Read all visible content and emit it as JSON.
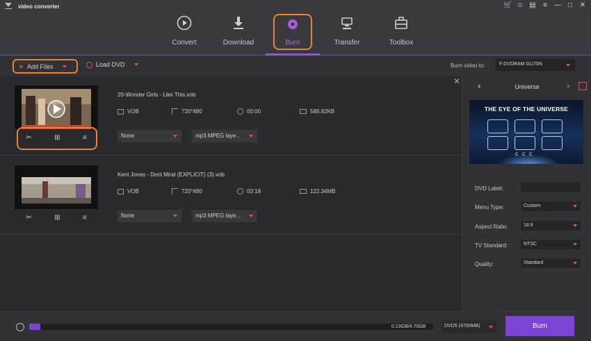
{
  "app": {
    "title": "video converter"
  },
  "colors": {
    "accent_purple": "#8b5ccf",
    "highlight_orange": "#e8833a",
    "burn_button": "#7b45d4",
    "dropdown_caret": "#e85050"
  },
  "nav": {
    "tabs": [
      {
        "label": "Convert",
        "icon": "play-circle-icon"
      },
      {
        "label": "Download",
        "icon": "download-icon"
      },
      {
        "label": "Burn",
        "icon": "disc-icon",
        "active": true
      },
      {
        "label": "Transfer",
        "icon": "transfer-icon"
      },
      {
        "label": "Toolbox",
        "icon": "toolbox-icon"
      }
    ]
  },
  "toolbar": {
    "add_files": "Add Files",
    "load_dvd": "Load DVD",
    "burn_to_label": "Burn video to:",
    "burn_to_value": "F:DVDRAM GU70N"
  },
  "files": [
    {
      "name": "20-Wonder Girls - Like This.vob",
      "format": "VOB",
      "resolution": "720*480",
      "duration": "00:00",
      "size": "588.82KB",
      "subtitle": "None",
      "audio": "mp3 MPEG laye..."
    },
    {
      "name": "Kent Jones - Dont Mind (EXPLICIT) (3).vob",
      "format": "VOB",
      "resolution": "720*480",
      "duration": "03:18",
      "size": "122.34MB",
      "subtitle": "None",
      "audio": "mp3 MPEG laye..."
    }
  ],
  "template_panel": {
    "name": "Universe",
    "preview_title": "THE EYE OF THE UNIVERSE",
    "preview_buttons": "C C C",
    "dvd_label": {
      "label": "DVD Label:",
      "value": ""
    },
    "menu_type": {
      "label": "Menu Type:",
      "value": "Custom"
    },
    "aspect_ratio": {
      "label": "Aspect Ratio:",
      "value": "16:9"
    },
    "tv_standard": {
      "label": "TV Standard:",
      "value": "NTSC"
    },
    "quality": {
      "label": "Quality:",
      "value": "Standard"
    }
  },
  "bottom": {
    "progress_text": "0.13GB/4.70GB",
    "progress_fraction": 0.028,
    "disc_type": "DVD5 (4700MB)",
    "burn_label": "Burn"
  }
}
